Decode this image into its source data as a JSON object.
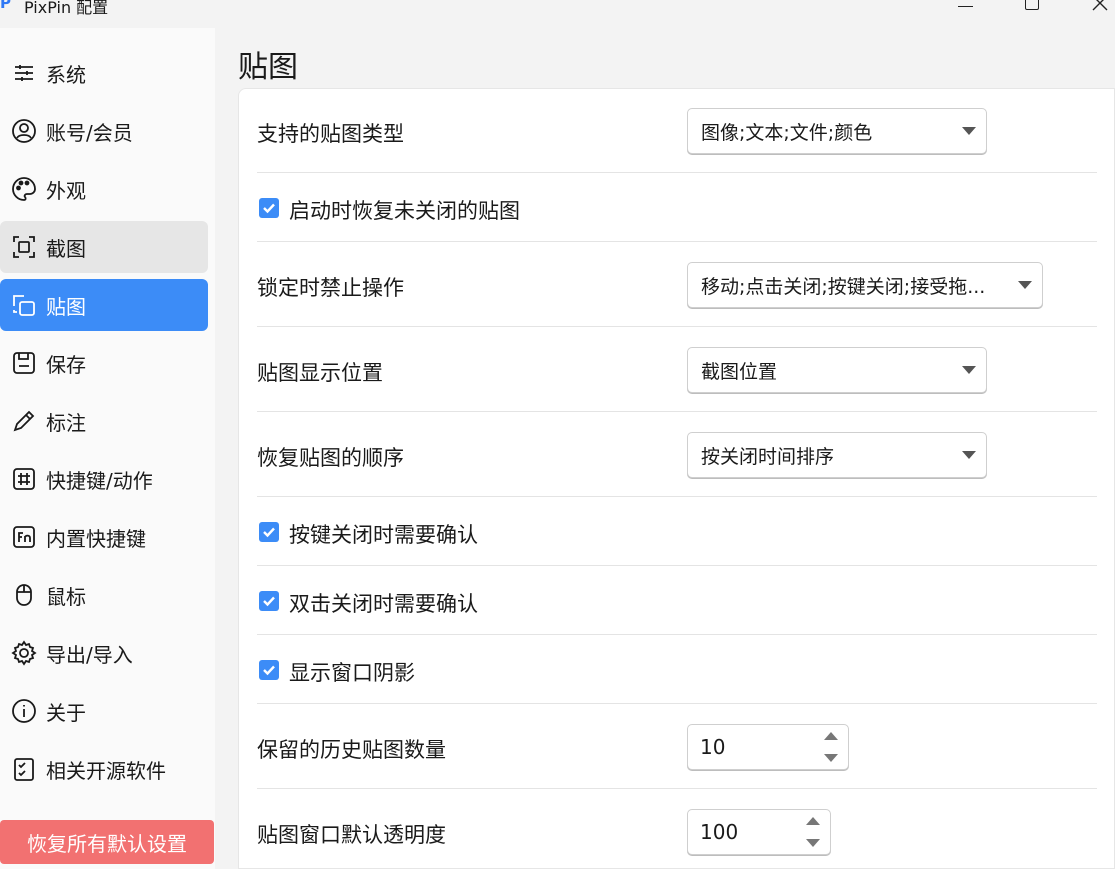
{
  "window": {
    "title": "PixPin 配置",
    "logo_text": "P"
  },
  "sidebar": {
    "items": [
      {
        "label": "系统",
        "icon": "sliders-icon"
      },
      {
        "label": "账号/会员",
        "icon": "user-circle-icon"
      },
      {
        "label": "外观",
        "icon": "palette-icon"
      },
      {
        "label": "截图",
        "icon": "screenshot-frame-icon"
      },
      {
        "label": "贴图",
        "icon": "pin-copy-icon"
      },
      {
        "label": "保存",
        "icon": "save-icon"
      },
      {
        "label": "标注",
        "icon": "pencil-icon"
      },
      {
        "label": "快捷键/动作",
        "icon": "hash-icon"
      },
      {
        "label": "内置快捷键",
        "icon": "fn-key-icon"
      },
      {
        "label": "鼠标",
        "icon": "mouse-icon"
      },
      {
        "label": "导出/导入",
        "icon": "gear-icon"
      },
      {
        "label": "关于",
        "icon": "info-icon"
      },
      {
        "label": "相关开源软件",
        "icon": "checklist-icon"
      }
    ],
    "active_index": 4,
    "hover_index": 3,
    "reset_label": "恢复所有默认设置"
  },
  "main": {
    "title": "贴图",
    "settings": {
      "pin_types": {
        "label": "支持的贴图类型",
        "value": "图像;文本;文件;颜色"
      },
      "restore_on_start": {
        "label": "启动时恢复未关闭的贴图",
        "checked": true
      },
      "lock_disable": {
        "label": "锁定时禁止操作",
        "value": "移动;点击关闭;按键关闭;接受拖..."
      },
      "display_position": {
        "label": "贴图显示位置",
        "value": "截图位置"
      },
      "restore_order": {
        "label": "恢复贴图的顺序",
        "value": "按关闭时间排序"
      },
      "confirm_key_close": {
        "label": "按键关闭时需要确认",
        "checked": true
      },
      "confirm_dblclick_close": {
        "label": "双击关闭时需要确认",
        "checked": true
      },
      "window_shadow": {
        "label": "显示窗口阴影",
        "checked": true
      },
      "history_count": {
        "label": "保留的历史贴图数量",
        "value": "10"
      },
      "default_opacity": {
        "label": "贴图窗口默认透明度",
        "value": "100"
      }
    }
  },
  "colors": {
    "accent": "#3c8cf7",
    "reset": "#f27171"
  }
}
